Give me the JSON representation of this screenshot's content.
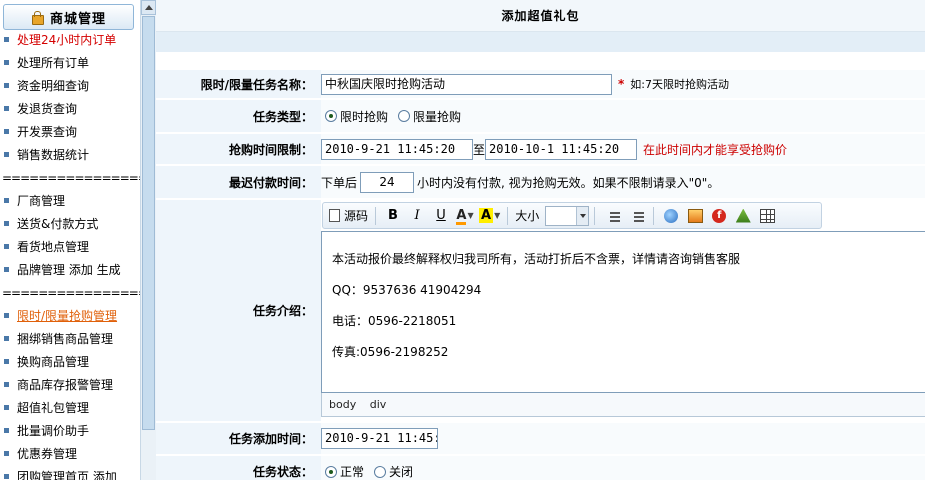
{
  "sidebar": {
    "header": "商城管理",
    "items": [
      {
        "label": "处理24小时内订单",
        "style": "red"
      },
      {
        "label": "处理所有订单"
      },
      {
        "label": "资金明细查询"
      },
      {
        "label": "发退货查询"
      },
      {
        "label": "开发票查询"
      },
      {
        "label": "销售数据统计"
      },
      {
        "sep": "===================="
      },
      {
        "label": "厂商管理"
      },
      {
        "label": "送货&付款方式"
      },
      {
        "label": "看货地点管理"
      },
      {
        "label": "品牌管理 添加 生成"
      },
      {
        "sep": "===================="
      },
      {
        "label": "限时/限量抢购管理",
        "style": "orange"
      },
      {
        "label": "捆绑销售商品管理"
      },
      {
        "label": "换购商品管理"
      },
      {
        "label": "商品库存报警管理"
      },
      {
        "label": "超值礼包管理"
      },
      {
        "label": "批量调价助手"
      },
      {
        "label": "优惠券管理"
      },
      {
        "label": "团购管理首页 添加"
      }
    ]
  },
  "page": {
    "title": "添加超值礼包"
  },
  "form": {
    "name_label": "限时/限量任务名称：",
    "name_value": "中秋国庆限时抢购活动",
    "name_required": "*",
    "name_hint": "如:7天限时抢购活动",
    "type_label": "任务类型：",
    "type_options": [
      "限时抢购",
      "限量抢购"
    ],
    "type_selected": 0,
    "time_label": "抢购时间限制：",
    "time_start": "2010-9-21 11:45:20",
    "time_to": "至",
    "time_end": "2010-10-1 11:45:20",
    "time_hint": "在此时间内才能享受抢购价",
    "pay_label": "最迟付款时间：",
    "pay_prefix": "下单后",
    "pay_hours": "24",
    "pay_suffix": "小时内没有付款, 视为抢购无效。如果不限制请录入\"0\"。",
    "intro_label": "任务介绍：",
    "add_time_label": "任务添加时间：",
    "add_time_value": "2010-9-21 11:45:",
    "status_label": "任务状态：",
    "status_options": [
      "正常",
      "关闭"
    ],
    "status_selected": 0
  },
  "editor": {
    "toolbar": {
      "source": "源码",
      "bold": "B",
      "italic": "I",
      "underline": "U",
      "font_color": "A",
      "highlight": "A",
      "size_label": "大小"
    },
    "lines": [
      "本活动报价最终解释权归我司所有，活动打折后不含票，详情请咨询销售客服",
      "QQ：9537636 41904294",
      "电话：0596-2218051",
      "传真:0596-2198252"
    ],
    "path": [
      "body",
      "div"
    ]
  },
  "colors": {
    "label_bg": "#eef5fb",
    "value_bg": "#f8fbfd",
    "accent_red": "#cc0000",
    "link_orange": "#e0600a"
  }
}
